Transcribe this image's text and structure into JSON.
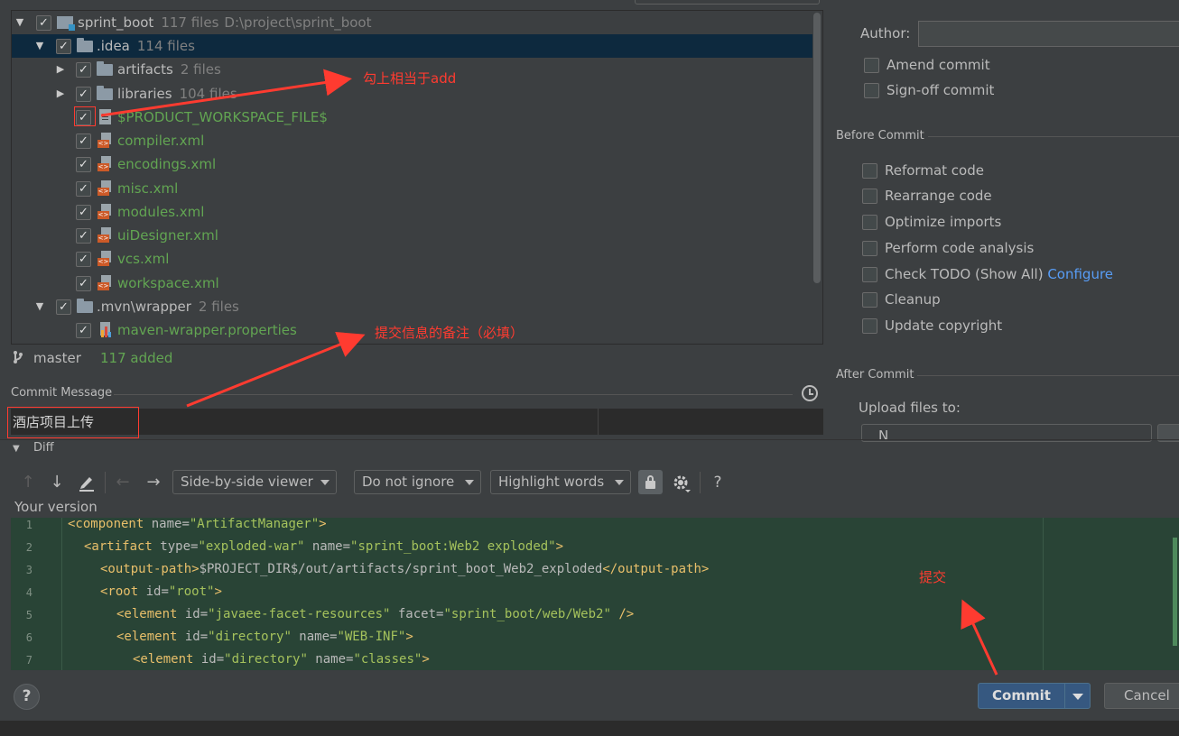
{
  "tree": {
    "rows": [
      {
        "label": "sprint_boot",
        "count": "117 files",
        "path": "D:\\project\\sprint_boot"
      },
      {
        "label": ".idea",
        "count": "114 files"
      },
      {
        "label": "artifacts",
        "count": "2 files"
      },
      {
        "label": "libraries",
        "count": "104 files"
      },
      {
        "label": "$PRODUCT_WORKSPACE_FILE$"
      },
      {
        "label": "compiler.xml"
      },
      {
        "label": "encodings.xml"
      },
      {
        "label": "misc.xml"
      },
      {
        "label": "modules.xml"
      },
      {
        "label": "uiDesigner.xml"
      },
      {
        "label": "vcs.xml"
      },
      {
        "label": "workspace.xml"
      },
      {
        "label": ".mvn\\wrapper",
        "count": "2 files"
      },
      {
        "label": "maven-wrapper.properties"
      }
    ],
    "check_mark": "✓",
    "expanded_glyph": "▼",
    "collapsed_glyph": "▶"
  },
  "status": {
    "branch": "master",
    "added": "117 added"
  },
  "commit_message": {
    "label": "Commit Message",
    "value": "酒店项目上传"
  },
  "diff": {
    "label": "Diff",
    "viewer": "Side-by-side viewer",
    "ignore": "Do not ignore",
    "highlight": "Highlight words",
    "help_glyph": "?",
    "your_version": "Your version",
    "lines": [
      {
        "n": "1"
      },
      {
        "n": "2"
      },
      {
        "n": "3"
      },
      {
        "n": "4"
      },
      {
        "n": "5"
      },
      {
        "n": "6"
      },
      {
        "n": "7"
      }
    ],
    "code": {
      "l1_tag": "<component",
      "l1_attr": " name=",
      "l1_val": "\"ArtifactManager\"",
      "l1_end": ">",
      "l2_tag": "<artifact",
      "l2_attr1": " type=",
      "l2_val1": "\"exploded-war\"",
      "l2_attr2": " name=",
      "l2_val2": "\"sprint_boot:Web2 exploded\"",
      "l2_end": ">",
      "l3_tag": "<output-path>",
      "l3_text": "$PROJECT_DIR$/out/artifacts/sprint_boot_Web2_exploded",
      "l3_close": "</output-path>",
      "l4_tag": "<root",
      "l4_attr": " id=",
      "l4_val": "\"root\"",
      "l4_end": ">",
      "l5_tag": "<element",
      "l5_attr1": " id=",
      "l5_val1": "\"javaee-facet-resources\"",
      "l5_attr2": " facet=",
      "l5_val2": "\"sprint_boot/web/Web2\"",
      "l5_end": " />",
      "l6_tag": "<element",
      "l6_attr1": " id=",
      "l6_val1": "\"directory\"",
      "l6_attr2": " name=",
      "l6_val2": "\"WEB-INF\"",
      "l6_end": ">",
      "l7_tag": "<element",
      "l7_attr1": " id=",
      "l7_val1": "\"directory\"",
      "l7_attr2": " name=",
      "l7_val2": "\"classes\"",
      "l7_end": ">"
    }
  },
  "right_panel": {
    "author_label": "Author:",
    "amend": "Amend commit",
    "signoff": "Sign-off commit",
    "before_commit": "Before Commit",
    "reformat": "Reformat code",
    "rearrange": "Rearrange code",
    "optimize": "Optimize imports",
    "analysis": "Perform code analysis",
    "todo": "Check TODO (Show All)",
    "configure": "Configure",
    "cleanup": "Cleanup",
    "copyright": "Update copyright",
    "after_commit": "After Commit",
    "upload": "Upload files to:",
    "upload_value": "N"
  },
  "buttons": {
    "commit": "Commit",
    "cancel": "Cancel",
    "help": "?"
  },
  "annotations": {
    "check_is_add": "勾上相当于add",
    "message_note": "提交信息的备注（必填）",
    "submit": "提交",
    "color": "#ff3b30"
  }
}
